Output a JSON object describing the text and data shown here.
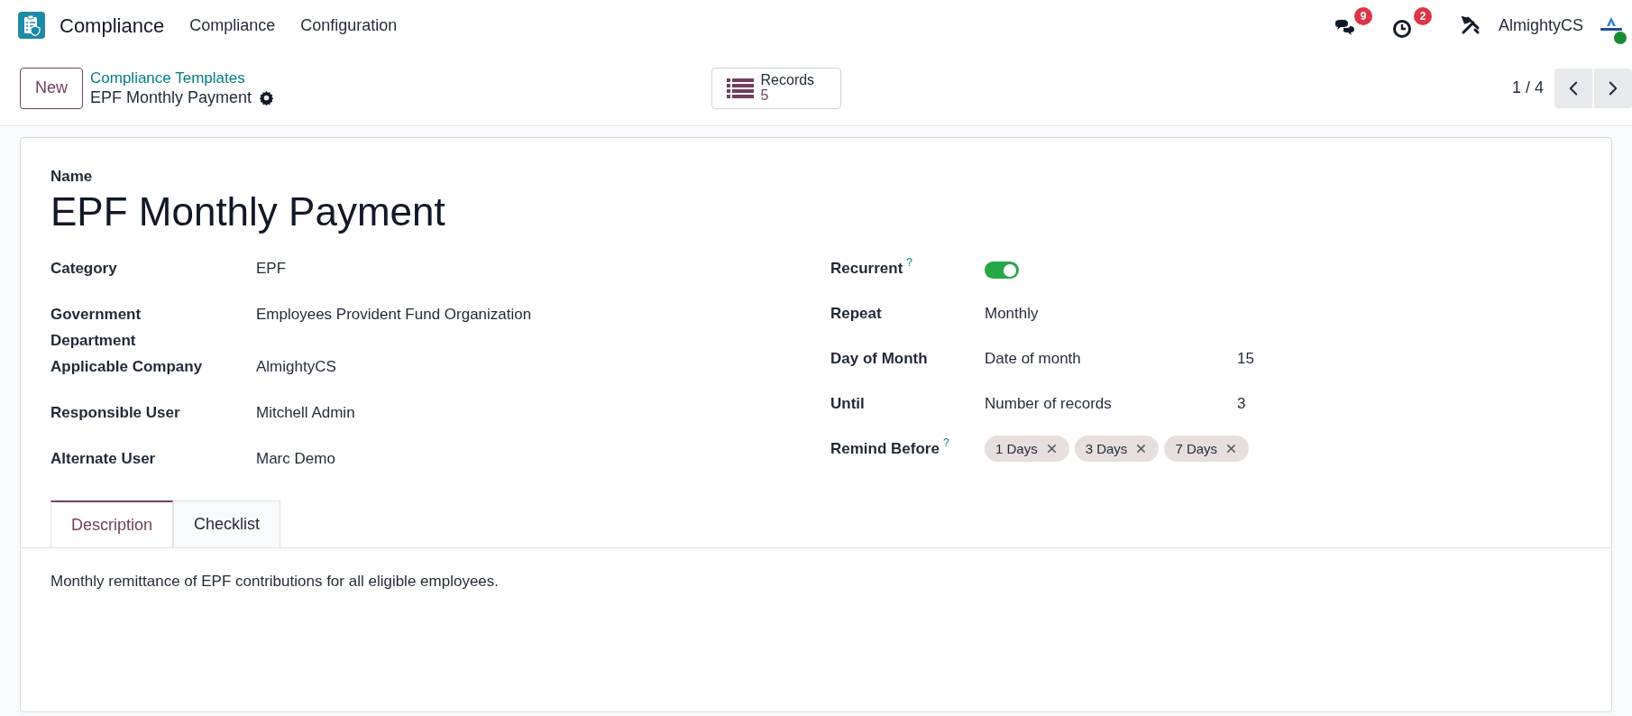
{
  "navbar": {
    "app_name": "Compliance",
    "menus": [
      "Compliance",
      "Configuration"
    ],
    "messages_badge": "9",
    "activities_badge": "2",
    "company": "AlmightyCS",
    "online": true
  },
  "control_panel": {
    "new_button": "New",
    "breadcrumb_parent": "Compliance Templates",
    "breadcrumb_current": "EPF Monthly Payment",
    "records_label": "Records",
    "records_count": "5",
    "pager": "1 / 4"
  },
  "form": {
    "name_label": "Name",
    "name": "EPF Monthly Payment",
    "left_fields": [
      {
        "label": "Category",
        "value": "EPF"
      },
      {
        "label": "Government Department",
        "value": "Employees Provident Fund Organization"
      },
      {
        "label": "Applicable Company",
        "value": "AlmightyCS"
      },
      {
        "label": "Responsible User",
        "value": "Mitchell Admin"
      },
      {
        "label": "Alternate User",
        "value": "Marc Demo"
      }
    ],
    "right_fields": [
      {
        "kind": "toggle",
        "label": "Recurrent",
        "help": "?",
        "on": true
      },
      {
        "kind": "text",
        "label": "Repeat",
        "value": "Monthly"
      },
      {
        "kind": "pair",
        "label": "Day of Month",
        "value": "Date of month",
        "extra": "15"
      },
      {
        "kind": "pair",
        "label": "Until",
        "value": "Number of records",
        "extra": "3"
      },
      {
        "kind": "tags",
        "label": "Remind Before",
        "help": "?",
        "tags": [
          "1 Days",
          "3 Days",
          "7 Days"
        ]
      }
    ],
    "tabs": [
      {
        "label": "Description",
        "selected": true
      },
      {
        "label": "Checklist",
        "selected": false
      }
    ],
    "description": "Monthly remittance of EPF contributions for all eligible employees."
  }
}
